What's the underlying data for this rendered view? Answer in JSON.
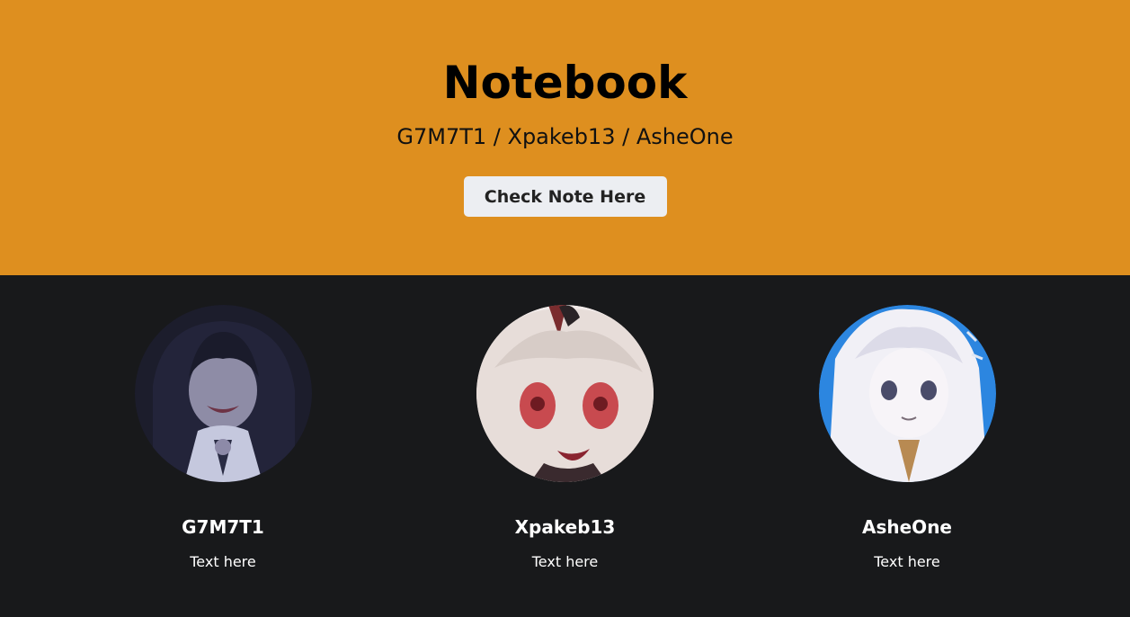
{
  "hero": {
    "title": "Notebook",
    "subtitle": "G7M7T1 / Xpakeb13 / AsheOne",
    "button_label": "Check Note Here",
    "background": "#de8f1f"
  },
  "members": [
    {
      "name": "G7M7T1",
      "text": "Text here",
      "avatar_icon": "avatar-dark-haired-character"
    },
    {
      "name": "Xpakeb13",
      "text": "Text here",
      "avatar_icon": "avatar-horned-character"
    },
    {
      "name": "AsheOne",
      "text": "Text here",
      "avatar_icon": "avatar-white-haired-character"
    }
  ],
  "colors": {
    "page_background": "#18191b",
    "button_background": "#eceef2"
  }
}
